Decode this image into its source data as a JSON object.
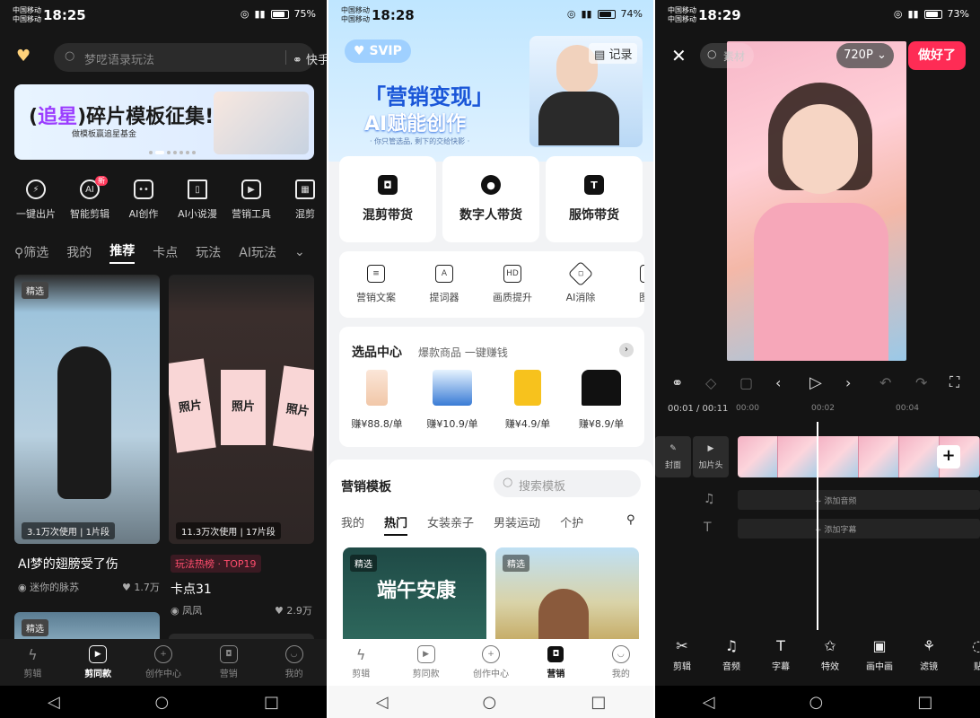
{
  "phone1": {
    "status": {
      "carrier1": "中国移动",
      "carrier2": "中国移动",
      "time": "18:25",
      "battery": "75%"
    },
    "search": {
      "placeholder": "梦呓语录玩法",
      "same_label": "快手同款"
    },
    "banner": {
      "title_prefix": "追星",
      "title": "碎片模板征集!",
      "subtitle": "做模板赢追星基金"
    },
    "tools": [
      {
        "label": "一键出片",
        "icon": "lightning-icon"
      },
      {
        "label": "智能剪辑",
        "icon": "ai-icon",
        "badge": "新"
      },
      {
        "label": "AI创作",
        "icon": "robot-icon"
      },
      {
        "label": "AI小说漫",
        "icon": "book-icon"
      },
      {
        "label": "营销工具",
        "icon": "play-icon"
      },
      {
        "label": "混剪",
        "icon": "clip-icon"
      }
    ],
    "filter_label": "筛选",
    "chips": [
      "我的",
      "推荐",
      "卡点",
      "玩法",
      "AI玩法"
    ],
    "cards": [
      {
        "tag": "精选",
        "usage": "3.1万次使用 | 1片段",
        "title": "AI梦的翅膀受了伤",
        "author": "迷你的脉苏",
        "likes": "1.7万"
      },
      {
        "usage": "11.3万次使用 | 17片段",
        "hot": "玩法热榜 · TOP19",
        "title": "卡点31",
        "author": "凤凤",
        "likes": "2.9万"
      }
    ],
    "card3_tag": "精选",
    "photo_word": "照片",
    "tabs": [
      {
        "label": "剪辑",
        "icon": "cut-icon"
      },
      {
        "label": "剪同款",
        "icon": "template-icon",
        "active": true
      },
      {
        "label": "创作中心",
        "icon": "create-icon"
      },
      {
        "label": "营销",
        "icon": "bag-icon"
      },
      {
        "label": "我的",
        "icon": "face-icon"
      }
    ]
  },
  "phone2": {
    "status": {
      "carrier1": "中国移动",
      "carrier2": "中国移动",
      "time": "18:28",
      "battery": "74%"
    },
    "svip": "SVIP",
    "record": "记录",
    "hero": {
      "line1": "「营销变现」",
      "line2": "AI赋能创作",
      "line3": "· 你只管选品, 剩下的交给快影 ·"
    },
    "big_buttons": [
      "混剪带货",
      "数字人带货",
      "服饰带货"
    ],
    "tools": [
      "营销文案",
      "提词器",
      "画质提升",
      "AI消除",
      "图文"
    ],
    "select_center": {
      "title": "选品中心",
      "subtitle": "爆款商品 一键赚钱",
      "items": [
        "赚¥88.8/单",
        "赚¥10.9/单",
        "赚¥4.9/单",
        "赚¥8.9/单"
      ]
    },
    "templates": {
      "title": "营销模板",
      "search_placeholder": "搜索模板",
      "tabs": [
        "我的",
        "热门",
        "女装亲子",
        "男装运动",
        "个护"
      ],
      "card1_tag": "精选",
      "card1_title": "端午安康",
      "card2_tag": "精选"
    },
    "tabs": [
      {
        "label": "剪辑",
        "icon": "cut-icon"
      },
      {
        "label": "剪同款",
        "icon": "template-icon"
      },
      {
        "label": "创作中心",
        "icon": "create-icon"
      },
      {
        "label": "营销",
        "icon": "bag-icon",
        "active": true
      },
      {
        "label": "我的",
        "icon": "face-icon"
      }
    ]
  },
  "phone3": {
    "status": {
      "carrier1": "中国移动",
      "carrier2": "中国移动",
      "time": "18:29",
      "battery": "73%"
    },
    "material": "素材",
    "resolution": "720P",
    "done": "做好了",
    "timecode": "00:01 / 00:11",
    "ticks": [
      "00:00",
      "00:02",
      "00:04"
    ],
    "cover_label": "封面",
    "add_intro": "加片头",
    "add_music": "+ 添加音频",
    "add_text": "+ 添加字幕",
    "tools": [
      "剪辑",
      "音频",
      "字幕",
      "特效",
      "画中画",
      "滤镜",
      "贴"
    ]
  }
}
